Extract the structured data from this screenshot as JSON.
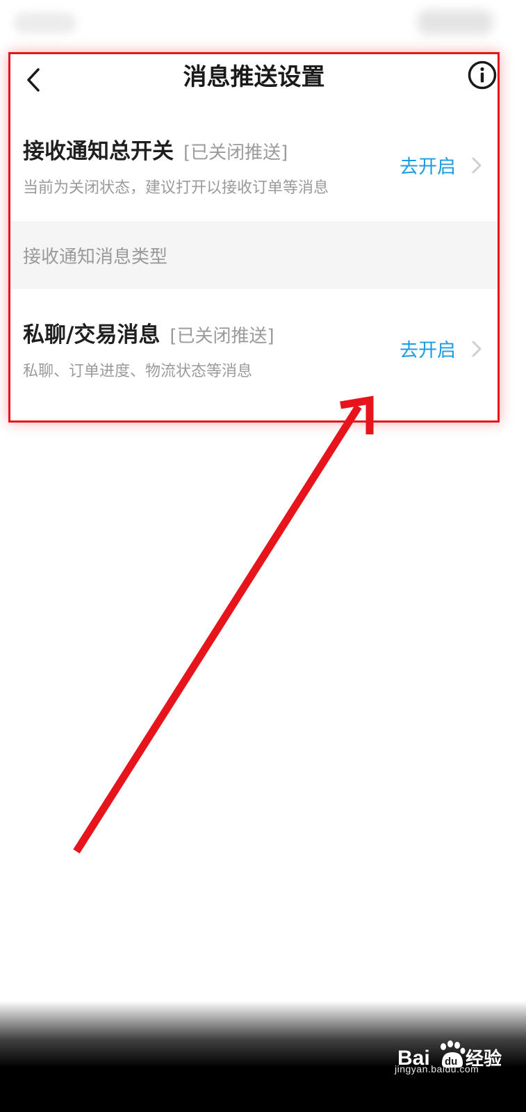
{
  "header": {
    "title": "消息推送设置",
    "back_icon": "chevron-left-icon",
    "info_icon": "info-circle-icon"
  },
  "master_switch": {
    "title": "接收通知总开关",
    "status": "[已关闭推送]",
    "description": "当前为关闭状态，建议打开以接收订单等消息",
    "action": "去开启"
  },
  "section": {
    "label": "接收通知消息类型"
  },
  "message_types": [
    {
      "title": "私聊/交易消息",
      "status": "[已关闭推送]",
      "description": "私聊、订单进度、物流状态等消息",
      "action": "去开启"
    }
  ],
  "watermark": {
    "logo_text": "Bai du 经验",
    "url": "jingyan.baidu.com"
  },
  "colors": {
    "accent": "#1b9be0",
    "annotation": "#e8141c",
    "title_text": "#1a1a1a",
    "secondary_text": "#9a9a9a",
    "section_bg": "#f5f5f5"
  }
}
